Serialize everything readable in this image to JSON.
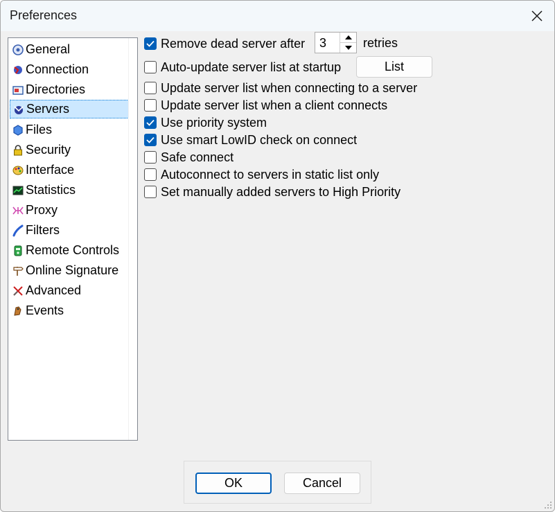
{
  "window": {
    "title": "Preferences"
  },
  "nav": {
    "selected": "Servers",
    "items": [
      {
        "label": "General",
        "icon": "general-icon"
      },
      {
        "label": "Connection",
        "icon": "connection-icon"
      },
      {
        "label": "Directories",
        "icon": "directories-icon"
      },
      {
        "label": "Servers",
        "icon": "servers-icon"
      },
      {
        "label": "Files",
        "icon": "files-icon"
      },
      {
        "label": "Security",
        "icon": "lock-icon"
      },
      {
        "label": "Interface",
        "icon": "palette-icon"
      },
      {
        "label": "Statistics",
        "icon": "statistics-icon"
      },
      {
        "label": "Proxy",
        "icon": "proxy-icon"
      },
      {
        "label": "Filters",
        "icon": "filters-icon"
      },
      {
        "label": "Remote Controls",
        "icon": "remote-controls-icon"
      },
      {
        "label": "Online Signature",
        "icon": "signpost-icon"
      },
      {
        "label": "Advanced",
        "icon": "advanced-icon"
      },
      {
        "label": "Events",
        "icon": "events-icon"
      }
    ]
  },
  "servers": {
    "remove_dead": {
      "label": "Remove dead server after",
      "checked": true
    },
    "retries_value": "3",
    "retries_label": "retries",
    "auto_update": {
      "label": "Auto-update server list at startup",
      "checked": false
    },
    "list_button": "List",
    "update_on_connect_server": {
      "label": "Update server list when connecting to a server",
      "checked": false
    },
    "update_on_client_connect": {
      "label": "Update server list when a client connects",
      "checked": false
    },
    "priority_system": {
      "label": "Use priority system",
      "checked": true
    },
    "smart_lowid": {
      "label": "Use smart LowID check on connect",
      "checked": true
    },
    "safe_connect": {
      "label": "Safe connect",
      "checked": false
    },
    "autoconnect_static": {
      "label": "Autoconnect to servers in static list only",
      "checked": false
    },
    "manual_high_priority": {
      "label": "Set manually added servers to High Priority",
      "checked": false
    }
  },
  "footer": {
    "ok": "OK",
    "cancel": "Cancel"
  },
  "colors": {
    "accent": "#005fb8",
    "selection": "#cce8ff"
  }
}
